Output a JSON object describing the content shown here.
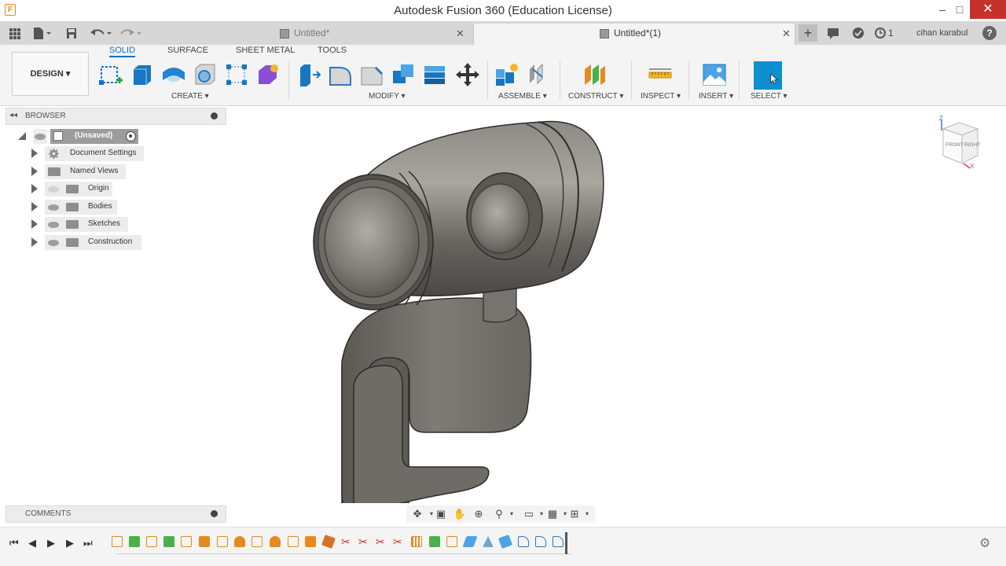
{
  "window": {
    "app_icon_letter": "F",
    "title": "Autodesk Fusion 360 (Education License)",
    "minimize": "–",
    "maximize": "□",
    "close": "✕"
  },
  "quick_access": {
    "icons": [
      "grid-icon",
      "file-icon",
      "save-icon",
      "undo-icon",
      "redo-icon"
    ]
  },
  "document_tabs": [
    {
      "label": "Untitled*",
      "active": false,
      "close": "✕"
    },
    {
      "label": "Untitled*(1)",
      "active": true,
      "close": "✕"
    }
  ],
  "top_right": {
    "add_tab": "+",
    "jobs_count": "1",
    "user_name": "cihan karabul",
    "help": "?"
  },
  "ribbon": {
    "workspace": "DESIGN ▾",
    "tabs": [
      "SOLID",
      "SURFACE",
      "SHEET METAL",
      "TOOLS"
    ],
    "active_tab": "SOLID",
    "groups": {
      "create": "CREATE ▾",
      "modify": "MODIFY ▾",
      "assemble": "ASSEMBLE ▾",
      "construct": "CONSTRUCT ▾",
      "inspect": "INSPECT ▾",
      "insert": "INSERT ▾",
      "select": "SELECT ▾"
    }
  },
  "browser": {
    "title": "BROWSER",
    "collapse": "◂◂",
    "root": "(Unsaved)",
    "items": [
      "Document Settings",
      "Named Views",
      "Origin",
      "Bodies",
      "Sketches",
      "Construction"
    ]
  },
  "comments": {
    "title": "COMMENTS"
  },
  "viewcube": {
    "faces": [
      "FRONT",
      "RIGHT"
    ],
    "axes": [
      "Z",
      "X"
    ]
  },
  "colors": {
    "accent": "#0b73c9",
    "close_red": "#c7312b",
    "select_blue": "#0d8fd1",
    "model_gray": "#6e6a66"
  }
}
